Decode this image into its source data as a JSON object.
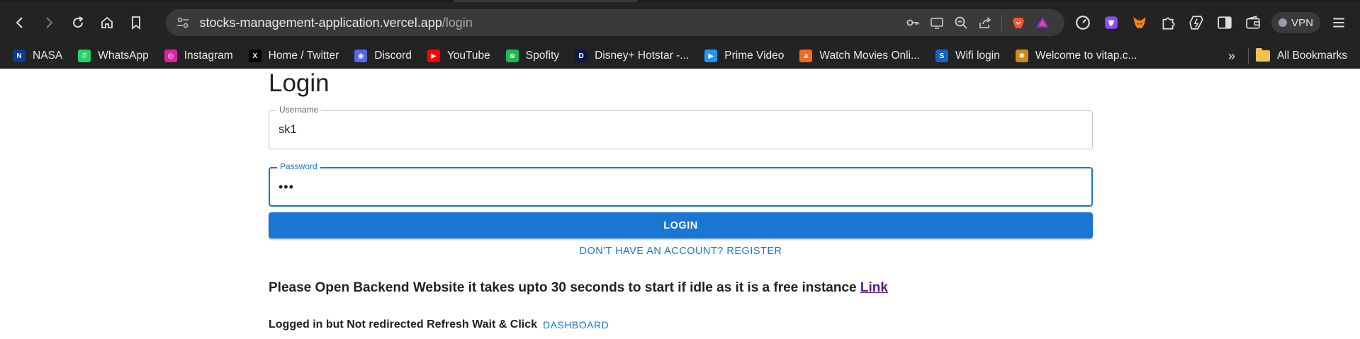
{
  "browser": {
    "url_host": "stocks-management-application.vercel.app",
    "url_path": "/login",
    "vpn_label": "VPN"
  },
  "bookmarks": [
    {
      "label": "NASA",
      "color": "#0b3d91",
      "glyph": "N"
    },
    {
      "label": "WhatsApp",
      "color": "#25d366",
      "glyph": "✆"
    },
    {
      "label": "Instagram",
      "color": "#d6249f",
      "glyph": "◎"
    },
    {
      "label": "Home / Twitter",
      "color": "#000000",
      "glyph": "X"
    },
    {
      "label": "Discord",
      "color": "#5865f2",
      "glyph": "◉"
    },
    {
      "label": "YouTube",
      "color": "#ff0000",
      "glyph": "▶"
    },
    {
      "label": "Spofity",
      "color": "#1db954",
      "glyph": "≋"
    },
    {
      "label": "Disney+ Hotstar -...",
      "color": "#0c1a45",
      "glyph": "D"
    },
    {
      "label": "Prime Video",
      "color": "#1a98ff",
      "glyph": "▶"
    },
    {
      "label": "Watch Movies Onli...",
      "color": "#f26b21",
      "glyph": "a"
    },
    {
      "label": "Wifi login",
      "color": "#1565c0",
      "glyph": "S"
    },
    {
      "label": "Welcome to vitap.c...",
      "color": "#d08a1c",
      "glyph": "✺"
    }
  ],
  "bookmarks_overflow": "»",
  "all_bookmarks_label": "All Bookmarks",
  "login": {
    "title": "Login",
    "username_label": "Username",
    "username_value": "sk1",
    "password_label": "Password",
    "password_value": "•••",
    "login_button": "LOGIN",
    "register_link": "DON'T HAVE AN ACCOUNT? REGISTER"
  },
  "notice": {
    "text": "Please Open Backend Website it takes upto 30 seconds to start if idle as it is a free instance ",
    "link": "Link"
  },
  "redirect": {
    "text": "Logged in but Not redirected Refresh Wait & Click",
    "dashboard": "DASHBOARD"
  },
  "colors": {
    "primary": "#1976d2",
    "chrome_bg": "#232323",
    "visited_link": "#551a8b"
  }
}
